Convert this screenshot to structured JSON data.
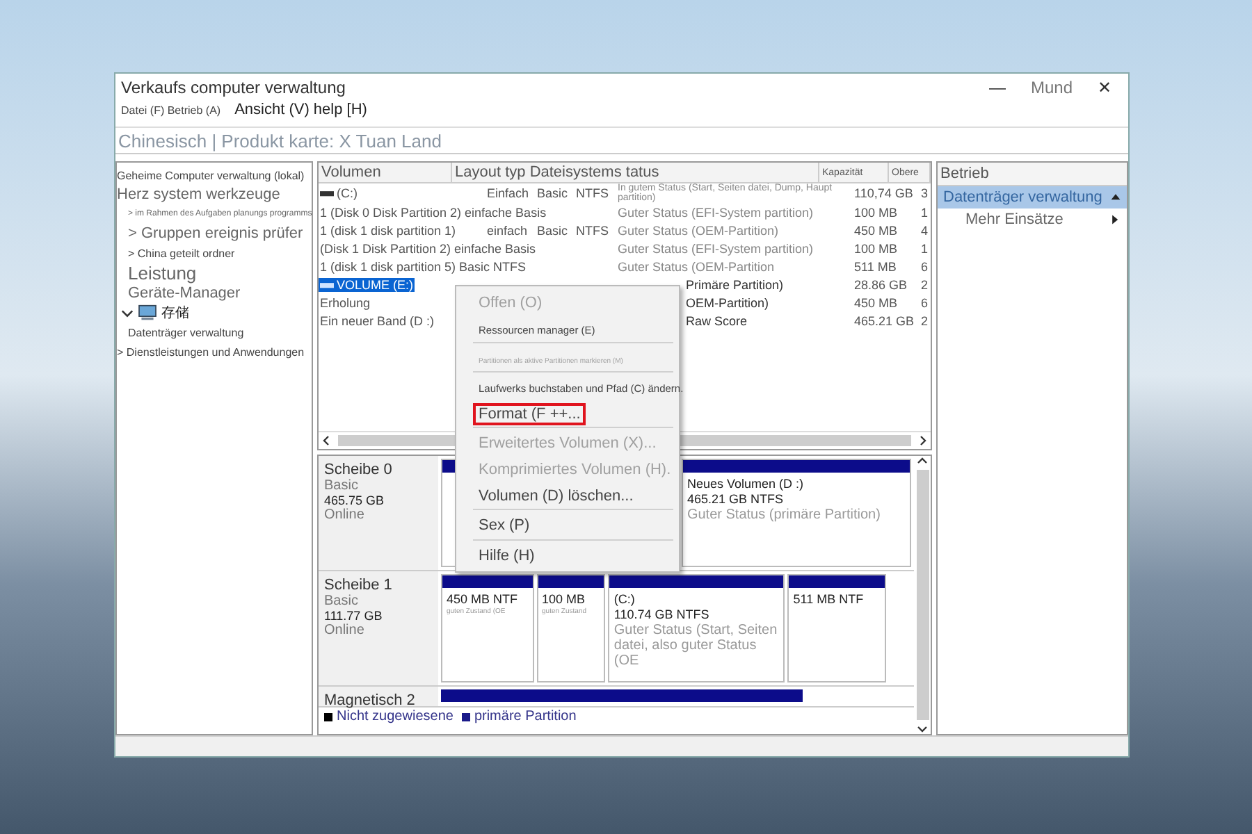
{
  "window": {
    "title": "Verkaufs computer verwaltung",
    "controls": [
      {
        "kind": "minimize",
        "label": "—"
      },
      {
        "kind": "text",
        "label": "Mund"
      },
      {
        "kind": "close",
        "label": "✕"
      }
    ]
  },
  "menu": [
    {
      "label": "Datei (F) Betrieb (A)",
      "kind": "small"
    },
    {
      "label": "Ansicht (V) help [H)",
      "kind": "normal"
    }
  ],
  "address": "Chinesisch | Produkt karte: X Tuan Land",
  "tree": [
    {
      "label": "Geheime Computer verwaltung (lokal)",
      "kind": "small"
    },
    {
      "label": "Herz system werkzeuge",
      "kind": "normal",
      "children": [
        {
          "label": "> im Rahmen des Aufgaben planungs programms",
          "kind": "tiny"
        },
        {
          "label": "> Gruppen ereignis prüfer",
          "kind": "normal"
        },
        {
          "label": "> China geteilt ordner",
          "kind": "small"
        },
        {
          "label": "Leistung",
          "kind": "large"
        },
        {
          "label": "Geräte-Manager",
          "kind": "normal"
        }
      ]
    },
    {
      "label": "存储",
      "kind": "storage",
      "expanded": true,
      "children": [
        {
          "label": "Datenträger verwaltung",
          "kind": "small"
        }
      ]
    },
    {
      "label": "> Dienstleistungen und Anwendungen",
      "kind": "small"
    }
  ],
  "volumes": {
    "columns": [
      "Volumen",
      "Layout typ Dateisystems tatus",
      "Kapazität",
      "Obere"
    ],
    "rows": [
      {
        "volume": "(C:)",
        "drive_icon": true,
        "layout": "Einfach",
        "type": "Basic",
        "fs": "NTFS",
        "status": "In gutem Status (Start, Seiten datei, Dump, Haupt partition)",
        "capacity": "110,74 GB",
        "free": "3",
        "selected": false
      },
      {
        "volume": "1 (Disk 0 Disk Partition 2) einfache Basis",
        "status": "Guter Status (EFI-System partition)",
        "capacity": "100 MB",
        "free": "1",
        "selected": false
      },
      {
        "volume": "1 (disk 1 disk partition 1)",
        "layout": "einfach",
        "type": "Basic",
        "fs": "NTFS",
        "status": "Guter Status (OEM-Partition)",
        "capacity": "450 MB",
        "free": "4",
        "selected": false
      },
      {
        "volume": "(Disk 1 Disk Partition 2) einfache Basis",
        "status": "Guter Status (EFI-System partition)",
        "capacity": "100 MB",
        "free": "1",
        "selected": false
      },
      {
        "volume": "1 (disk 1 disk partition 5) Basic NTFS",
        "status": "Guter Status (OEM-Partition",
        "capacity": "511 MB",
        "free": "6",
        "selected": false
      },
      {
        "volume": "VOLUME (E:)",
        "drive_icon": true,
        "status": "Primäre Partition)",
        "capacity": "28.86 GB",
        "free": "2",
        "selected": true
      },
      {
        "volume": "Erholung",
        "status": "OEM-Partition)",
        "capacity": "450 MB",
        "free": "6",
        "selected": false
      },
      {
        "volume": "Ein neuer Band (D :)",
        "status": "Raw Score",
        "capacity": "465.21 GB",
        "free": "2",
        "selected": false
      }
    ]
  },
  "context_menu": [
    {
      "kind": "item",
      "label": "Offen (O)",
      "disabled": true,
      "highlighted": false
    },
    {
      "kind": "small-item",
      "label": "Ressourcen manager (E)",
      "disabled": false,
      "highlighted": false
    },
    {
      "kind": "separator"
    },
    {
      "kind": "tiny-item",
      "label": "Partitionen als aktive Partitionen markieren (M)",
      "disabled": true,
      "highlighted": false
    },
    {
      "kind": "separator"
    },
    {
      "kind": "small-item",
      "label": "Laufwerks buchstaben und Pfad (C) ändern.",
      "disabled": false,
      "highlighted": false
    },
    {
      "kind": "item",
      "label": "Format (F ++...",
      "disabled": false,
      "highlighted": true
    },
    {
      "kind": "separator"
    },
    {
      "kind": "item",
      "label": "Erweitertes Volumen (X)...",
      "disabled": true,
      "highlighted": false
    },
    {
      "kind": "item",
      "label": "Komprimiertes Volumen (H).",
      "disabled": true,
      "highlighted": false
    },
    {
      "kind": "item",
      "label": "Volumen (D) löschen...",
      "disabled": false,
      "highlighted": false
    },
    {
      "kind": "separator"
    },
    {
      "kind": "item",
      "label": "Sex (P)",
      "disabled": false,
      "highlighted": false
    },
    {
      "kind": "separator"
    },
    {
      "kind": "item",
      "label": "Hilfe (H)",
      "disabled": false,
      "highlighted": false
    }
  ],
  "disks": [
    {
      "name": "Scheibe 0",
      "type": "Basic",
      "size": "465.75 GB",
      "status": "Online",
      "partitions": [
        {
          "kind": "blank"
        },
        {
          "kind": "blank"
        },
        {
          "kind": "volume",
          "title": "Neues Volumen (D :)",
          "size": "465.21 GB NTFS",
          "status": "Guter Status (primäre Partition)"
        }
      ]
    },
    {
      "name": "Scheibe 1",
      "type": "Basic",
      "size": "111.77 GB",
      "status": "Online",
      "partitions": [
        {
          "kind": "volume",
          "size": "450 MB NTF",
          "status": "guten Zustand (OE"
        },
        {
          "kind": "volume",
          "size": "100 MB",
          "status": "guten Zustand"
        },
        {
          "kind": "volume",
          "title": "(C:)",
          "size": "110.74 GB NTFS",
          "status": "Guter Status (Start, Seiten datei, also guter Status (OE"
        },
        {
          "kind": "volume",
          "size": "511 MB NTF"
        }
      ]
    },
    {
      "name": "Magnetisch 2",
      "partitions": [
        {
          "kind": "bar"
        }
      ]
    }
  ],
  "legend": [
    {
      "label": "Nicht zugewiesene",
      "color": "#000000"
    },
    {
      "label": "primäre Partition",
      "color": "#1a1a8a"
    }
  ],
  "actions": {
    "title": "Betrieb",
    "items": [
      {
        "label": "Datenträger verwaltung",
        "selected": true,
        "kind": "group"
      },
      {
        "label": "Mehr Einsätze",
        "selected": false,
        "kind": "submenu"
      }
    ]
  }
}
